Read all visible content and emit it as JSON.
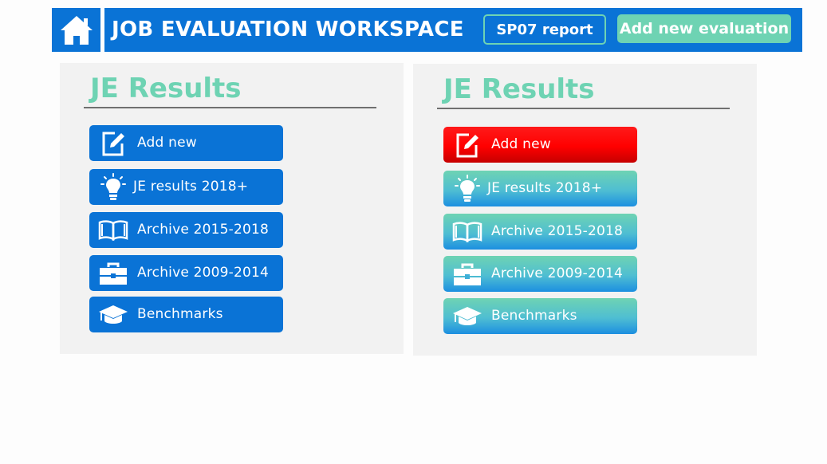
{
  "header": {
    "home_icon": "home-icon",
    "title": "JOB EVALUATION WORKSPACE",
    "sp07_label": "SP07 report",
    "add_evaluation_label": "Add new evaluation"
  },
  "colors": {
    "primary_blue": "#0a73d6",
    "accent_green": "#6ed3b3",
    "panel_bg": "#f2f2f2",
    "active_red": "#ff0000"
  },
  "panels": [
    {
      "title": "JE Results",
      "style": "default",
      "items": [
        {
          "label": "Add new",
          "icon": "edit-icon"
        },
        {
          "label": "JE results 2018+",
          "icon": "lightbulb-icon"
        },
        {
          "label": "Archive 2015-2018",
          "icon": "book-icon"
        },
        {
          "label": "Archive 2009-2014",
          "icon": "briefcase-icon"
        },
        {
          "label": "Benchmarks",
          "icon": "graduation-cap-icon"
        }
      ]
    },
    {
      "title": "JE Results",
      "style": "hover-state",
      "items": [
        {
          "label": "Add new",
          "icon": "edit-icon",
          "state": "active"
        },
        {
          "label": "JE results 2018+",
          "icon": "lightbulb-icon"
        },
        {
          "label": "Archive 2015-2018",
          "icon": "book-icon"
        },
        {
          "label": "Archive 2009-2014",
          "icon": "briefcase-icon"
        },
        {
          "label": "Benchmarks",
          "icon": "graduation-cap-icon"
        }
      ]
    }
  ]
}
